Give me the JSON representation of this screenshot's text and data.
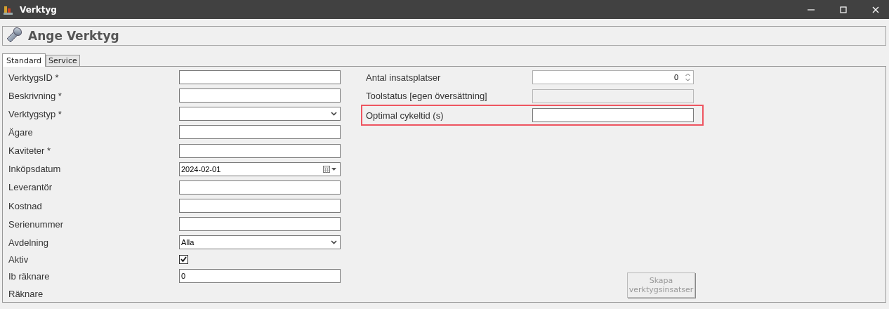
{
  "window": {
    "title": "Verktyg"
  },
  "header": {
    "title": "Ange Verktyg"
  },
  "tabs": [
    {
      "label": "Standard",
      "selected": true
    },
    {
      "label": "Service",
      "selected": false
    }
  ],
  "left_fields": [
    {
      "label": "VerktygsID *",
      "kind": "text"
    },
    {
      "label": "Beskrivning *",
      "kind": "text"
    },
    {
      "label": "Verktygstyp *",
      "kind": "select"
    },
    {
      "label": "Ägare",
      "kind": "text"
    },
    {
      "label": "Kaviteter *",
      "kind": "text"
    },
    {
      "label": "Inköpsdatum",
      "kind": "date",
      "value": "2024-02-01"
    },
    {
      "label": "Leverantör",
      "kind": "text"
    },
    {
      "label": "Kostnad",
      "kind": "text"
    },
    {
      "label": "Serienummer",
      "kind": "text"
    },
    {
      "label": "Avdelning",
      "kind": "select",
      "value": "Alla"
    },
    {
      "label": "Aktiv",
      "kind": "checkbox",
      "checked": true
    },
    {
      "label": "Ib räknare",
      "kind": "text",
      "value": "0"
    },
    {
      "label": "Räknare",
      "kind": "none"
    }
  ],
  "right_fields": [
    {
      "label": "Antal insatsplatser",
      "kind": "spinner",
      "value": "0",
      "disabled": false,
      "highlighted": false
    },
    {
      "label": "Toolstatus [egen översättning]",
      "kind": "text",
      "disabled": true,
      "highlighted": false
    },
    {
      "label": "Optimal cykeltid (s)",
      "kind": "text",
      "disabled": false,
      "highlighted": true
    }
  ],
  "button": {
    "label": "Skapa verktygsinsatser",
    "disabled": true
  }
}
